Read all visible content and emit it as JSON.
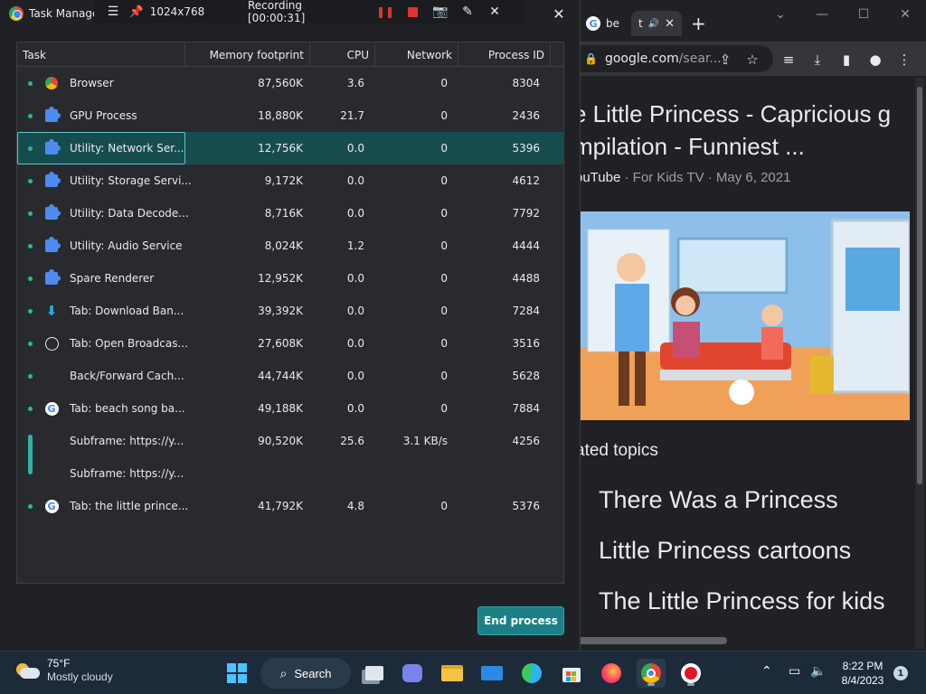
{
  "taskmgr": {
    "title": "Task Manager",
    "columns": [
      "Task",
      "Memory footprint",
      "CPU",
      "Network",
      "Process ID"
    ],
    "rows": [
      {
        "name": "Browser",
        "icon": "chrome-icon",
        "mem": "87,560K",
        "cpu": "3.6",
        "net": "0",
        "pid": "8304"
      },
      {
        "name": "GPU Process",
        "icon": "puzzle-icon",
        "mem": "18,880K",
        "cpu": "21.7",
        "net": "0",
        "pid": "2436"
      },
      {
        "name": "Utility: Network Ser...",
        "icon": "puzzle-icon",
        "mem": "12,756K",
        "cpu": "0.0",
        "net": "0",
        "pid": "5396"
      },
      {
        "name": "Utility: Storage Servi...",
        "icon": "puzzle-icon",
        "mem": "9,172K",
        "cpu": "0.0",
        "net": "0",
        "pid": "4612"
      },
      {
        "name": "Utility: Data Decode...",
        "icon": "puzzle-icon",
        "mem": "8,716K",
        "cpu": "0.0",
        "net": "0",
        "pid": "7792"
      },
      {
        "name": "Utility: Audio Service",
        "icon": "puzzle-icon",
        "mem": "8,024K",
        "cpu": "1.2",
        "net": "0",
        "pid": "4444"
      },
      {
        "name": "Spare Renderer",
        "icon": "puzzle-icon",
        "mem": "12,952K",
        "cpu": "0.0",
        "net": "0",
        "pid": "4488"
      },
      {
        "name": "Tab: Download Ban...",
        "icon": "download-icon",
        "mem": "39,392K",
        "cpu": "0.0",
        "net": "0",
        "pid": "7284"
      },
      {
        "name": "Tab: Open Broadcas...",
        "icon": "obs-icon",
        "mem": "27,608K",
        "cpu": "0.0",
        "net": "0",
        "pid": "3516"
      },
      {
        "name": "Back/Forward Cach...",
        "icon": "",
        "mem": "44,744K",
        "cpu": "0.0",
        "net": "0",
        "pid": "5628"
      },
      {
        "name": "Tab: beach song ba...",
        "icon": "google-icon",
        "mem": "49,188K",
        "cpu": "0.0",
        "net": "0",
        "pid": "7884"
      },
      {
        "name": "Subframe: https://y...",
        "icon": "",
        "mem": "90,520K",
        "cpu": "25.6",
        "net": "3.1 KB/s",
        "pid": "4256"
      },
      {
        "name": "Subframe: https://y...",
        "icon": "",
        "mem": "",
        "cpu": "",
        "net": "",
        "pid": ""
      },
      {
        "name": "Tab: the little prince...",
        "icon": "google-icon",
        "mem": "41,792K",
        "cpu": "4.8",
        "net": "0",
        "pid": "5376"
      }
    ],
    "end_button": "End process"
  },
  "recorder": {
    "resolution": "1024x768",
    "status": "Recording [00:00:31]"
  },
  "browser": {
    "tabs": [
      {
        "label": "be"
      },
      {
        "label": "t"
      }
    ],
    "url_domain": "google.com",
    "url_path": "/sear...",
    "result_title_line1": "e Little Princess - Capricious g",
    "result_title_line2": "mpilation - Funniest ...",
    "result_source": "ouTube",
    "result_meta": " · For Kids TV · May 6, 2021",
    "related_heading": "ated topics",
    "related": [
      "There Was a Princess",
      "Little Princess cartoons",
      "The Little Princess for kids"
    ]
  },
  "taskbar": {
    "temp": "75°F",
    "condition": "Mostly cloudy",
    "search_label": "Search",
    "time": "8:22 PM",
    "date": "8/4/2023",
    "notifications": "1"
  },
  "colors": {
    "accent": "#1d7f86",
    "selection": "#174c4f",
    "bg": "#202124"
  }
}
